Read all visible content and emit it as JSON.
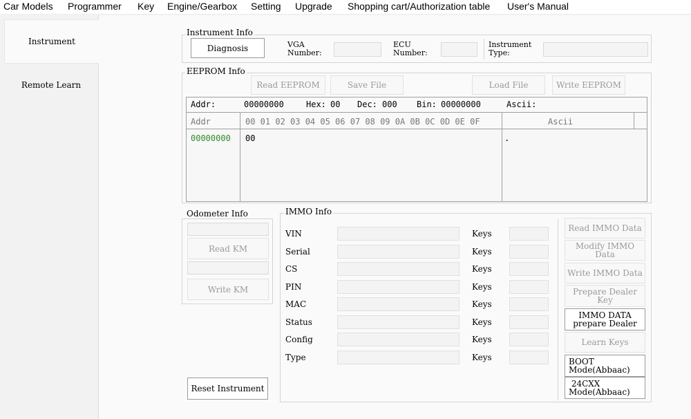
{
  "menu": [
    "Car Models",
    "Programmer",
    "Key",
    "Engine/Gearbox",
    "Setting",
    "Upgrade",
    "Shopping cart/Authorization table",
    "User's Manual"
  ],
  "sidebar": {
    "items": [
      {
        "label": "Instrument"
      },
      {
        "label": "Remote Learn"
      }
    ]
  },
  "instrument_info": {
    "title": "Instrument Info",
    "diagnosis": "Diagnosis",
    "vga_label": "VGA\nNumber:",
    "ecu_label": "ECU\nNumber:",
    "type_label": "Instrument\nType:",
    "vga_value": "",
    "ecu_value": "",
    "type_value": ""
  },
  "eeprom": {
    "title": "EEPROM Info",
    "buttons": [
      "Read EEPROM",
      "Save File",
      "Load File",
      "Write EEPROM"
    ],
    "addr_label": "Addr:",
    "addr_value": "00000000",
    "hex_label": "Hex:",
    "hex_value": "00",
    "dec_label": "Dec:",
    "dec_value": "000",
    "bin_label": "Bin:",
    "bin_value": "00000000",
    "ascii_label": "Ascii:",
    "col_addr": "Addr",
    "col_hex": "00 01 02 03 04 05 06 07 08 09 0A 0B 0C 0D 0E 0F",
    "col_ascii": "Ascii",
    "row_addr": "00000000",
    "row_hex": "00",
    "row_ascii": ".",
    "addr_color": "#2e8b2e"
  },
  "odometer": {
    "title": "Odometer Info",
    "read": "Read KM",
    "write": "Write KM"
  },
  "immo": {
    "title": "IMMO Info",
    "fields": [
      "VIN",
      "Serial",
      "CS",
      "PIN",
      "MAC",
      "Status",
      "Config",
      "Type"
    ],
    "keys_label": "Keys",
    "buttons": [
      "Read IMMO Data",
      "Modify IMMO Data",
      "Write IMMO Data",
      "Prepare Dealer\nKey",
      "IMMO DATA\nprepare Dealer",
      "Learn Keys",
      "BOOT\nMode(Abbaac)",
      " 24CXX\nMode(Abbaac)"
    ]
  },
  "reset": "Reset Instrument"
}
